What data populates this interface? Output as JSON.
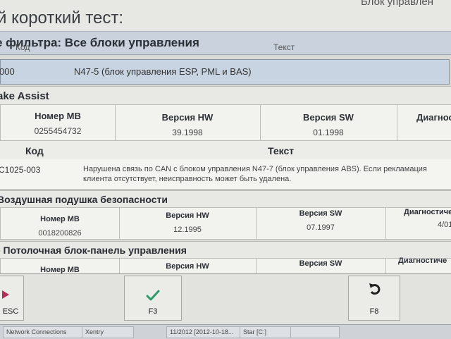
{
  "header": {
    "title": "й короткий тест:",
    "right_text": "Блок управлен"
  },
  "filter": {
    "label": "е фильтра: Все блоки управления"
  },
  "table_headers": {
    "code": "Код",
    "text": "Текст"
  },
  "selected_row": {
    "code": "000",
    "text": "N47-5 (блок управления ESP, PML и BAS)"
  },
  "brake_assist": {
    "title": "ake Assist",
    "columns": [
      "Номер MB",
      "Версия HW",
      "Версия SW",
      "Диагност"
    ],
    "values": [
      "0255454732",
      "39.1998",
      "01.1998",
      ""
    ]
  },
  "fault_table": {
    "header_code": "Код",
    "header_text": "Текст",
    "code": "C1025-003",
    "text": "Нарушена связь по CAN с блоком управления N47-7 (блок управления ABS). Если рекламация клиента отсутствует, неисправность может быть удалена."
  },
  "airbag": {
    "title": "Воздушная подушка безопасности",
    "columns": [
      "Номер MB",
      "Версия HW",
      "Версия SW",
      "Диагностиче"
    ],
    "values": [
      "0018200826",
      "12.1995",
      "07.1997",
      "4/01"
    ]
  },
  "ceiling_panel": {
    "title": "- Потолочная блок-панель управления",
    "columns": [
      "Номер MB",
      "Версия HW",
      "Версия SW",
      "Диагностиче"
    ],
    "values": [
      "- - - - - - - - - -",
      "",
      "",
      ""
    ]
  },
  "fkeys": {
    "esc": "ESC",
    "f3": "F3",
    "f8": "F8"
  },
  "taskbar": {
    "items": [
      "Network Connections",
      "Xentry",
      "11/2012 [2012-10-18...",
      "Star [C:]",
      ""
    ]
  },
  "colors": {
    "accent_check": "#2f9a6a",
    "selected_row": "#c8d4e2",
    "filter_bar": "#c9d2dd"
  }
}
